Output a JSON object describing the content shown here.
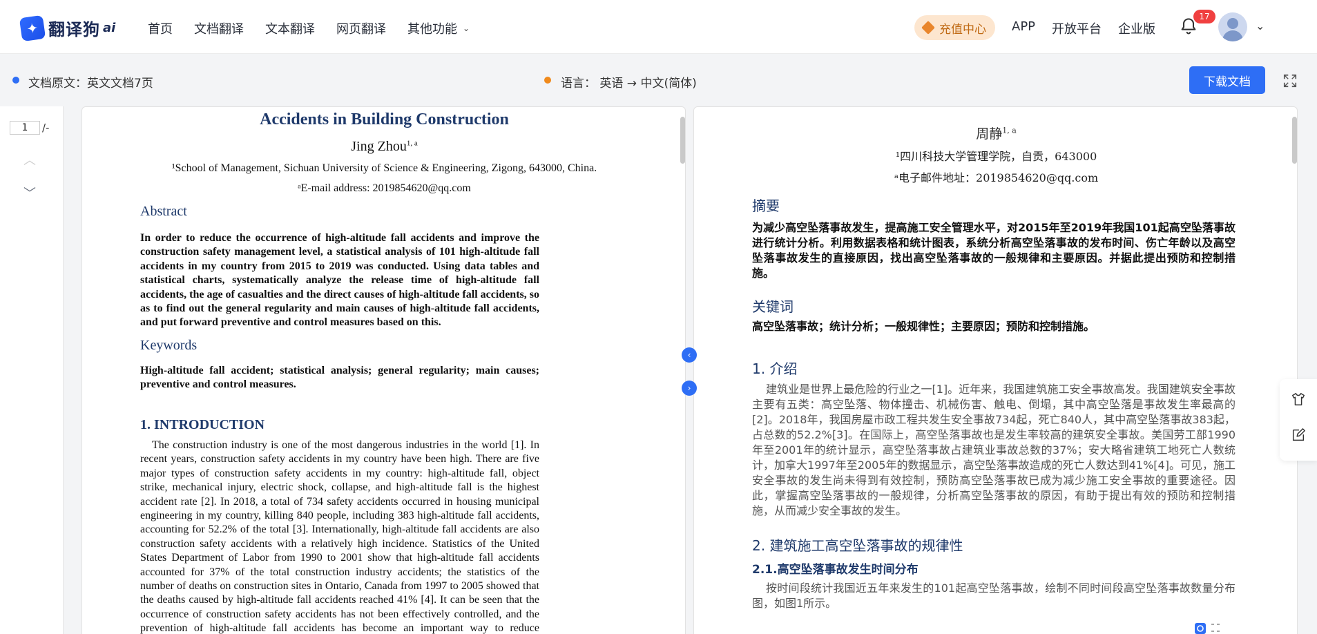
{
  "header": {
    "brand": "翻译狗",
    "brand_ai": "ai",
    "nav": [
      "首页",
      "文档翻译",
      "文本翻译",
      "网页翻译",
      "其他功能"
    ],
    "recharge": "充值中心",
    "links": [
      "APP",
      "开放平台",
      "企业版"
    ],
    "notification_count": "17"
  },
  "info": {
    "source": "文档原文：英文文档7页",
    "language": "语言：  英语 → 中文(简体)",
    "download": "下载文档",
    "source_dot_color": "#2e6ef5",
    "language_dot_color": "#f08a1c"
  },
  "pager": {
    "current": "1",
    "total": "/-"
  },
  "original": {
    "title": "Accidents in Building Construction",
    "author": "Jing Zhou",
    "author_sup": "1, a",
    "affiliation": "¹School of Management, Sichuan University of Science & Engineering, Zigong, 643000, China.",
    "email": "ᵃE-mail address: 2019854620@qq.com",
    "abstract_head": "Abstract",
    "abstract": "In order to reduce the occurrence of high-altitude fall accidents and improve the construction safety management level, a statistical analysis of 101 high-altitude fall accidents in my country from 2015 to 2019 was conducted. Using data tables and statistical charts, systematically analyze the release time of high-altitude fall accidents, the age of casualties and the direct causes of high-altitude fall accidents, so as to find out the general regularity and main causes of high-altitude fall accidents, and put forward preventive and control measures based on this.",
    "keywords_head": "Keywords",
    "keywords": "High-altitude fall accident; statistical analysis; general regularity; main causes; preventive and control measures.",
    "intro_head": "1.   INTRODUCTION",
    "intro": "The construction industry is one of the most dangerous industries in the world [1]. In recent years, construction safety accidents in my country have been high. There are five major types of construction safety accidents in my country: high-altitude fall, object strike, mechanical injury, electric shock, collapse, and high-altitude fall is the highest accident rate [2]. In 2018, a total of 734 safety accidents occurred in housing municipal engineering in my country, killing 840 people, including 383 high-altitude fall accidents, accounting for 52.2% of the total [3]. Internationally, high-altitude fall accidents are also construction safety accidents with a relatively high incidence. Statistics of the United States Department of Labor from 1990 to 2001 show that high-altitude fall accidents accounted for 37% of the total construction industry accidents; the statistics of the number of deaths on construction sites in Ontario, Canada from 1997 to 2005 showed that the deaths caused by high-altitude fall accidents reached 41% [4]. It can be seen that the occurrence of construction safety accidents has not been effectively controlled, and the prevention of high-altitude fall accidents has become an important way to reduce construction safety accidents. Therefore, mastering the general regularity of high-"
  },
  "translation": {
    "author": "周静",
    "author_sup": "1, a",
    "affiliation": "¹四川科技大学管理学院，自贡，643000",
    "email": "ᵃ电子邮件地址：2019854620@qq.com",
    "abstract_head": "摘要",
    "abstract": "为减少高空坠落事故发生，提高施工安全管理水平，对2015年至2019年我国101起高空坠落事故进行统计分析。利用数据表格和统计图表，系统分析高空坠落事故的发布时间、伤亡年龄以及高空坠落事故发生的直接原因，找出高空坠落事故的一般规律和主要原因。并据此提出预防和控制措施。",
    "keywords_head": "关键词",
    "keywords": "高空坠落事故；统计分析；一般规律性；主要原因；预防和控制措施。",
    "intro_head": "1.  介绍",
    "intro": "建筑业是世界上最危险的行业之一[1]。近年来，我国建筑施工安全事故高发。我国建筑安全事故主要有五类：高空坠落、物体撞击、机械伤害、触电、倒塌，其中高空坠落是事故发生率最高的[2]。2018年，我国房屋市政工程共发生安全事故734起，死亡840人，其中高空坠落事故383起，占总数的52.2%[3]。在国际上，高空坠落事故也是发生率较高的建筑安全事故。美国劳工部1990年至2001年的统计显示，高空坠落事故占建筑业事故总数的37%；安大略省建筑工地死亡人数统计，加拿大1997年至2005年的数据显示，高空坠落事故造成的死亡人数达到41%[4]。可见，施工安全事故的发生尚未得到有效控制，预防高空坠落事故已成为减少施工安全事故的重要途径。因此，掌握高空坠落事故的一般规律，分析高空坠落事故的原因，有助于提出有效的预防和控制措施，从而减少安全事故的发生。",
    "sec2_head": "2.  建筑施工高空坠落事故的规律性",
    "sec21_head": "2.1.高空坠落事故发生时间分布",
    "sec21": "按时间段统计我国近五年来发生的101起高空坠落事故，绘制不同时间段高空坠落事故数量分布图，如图1所示。"
  }
}
